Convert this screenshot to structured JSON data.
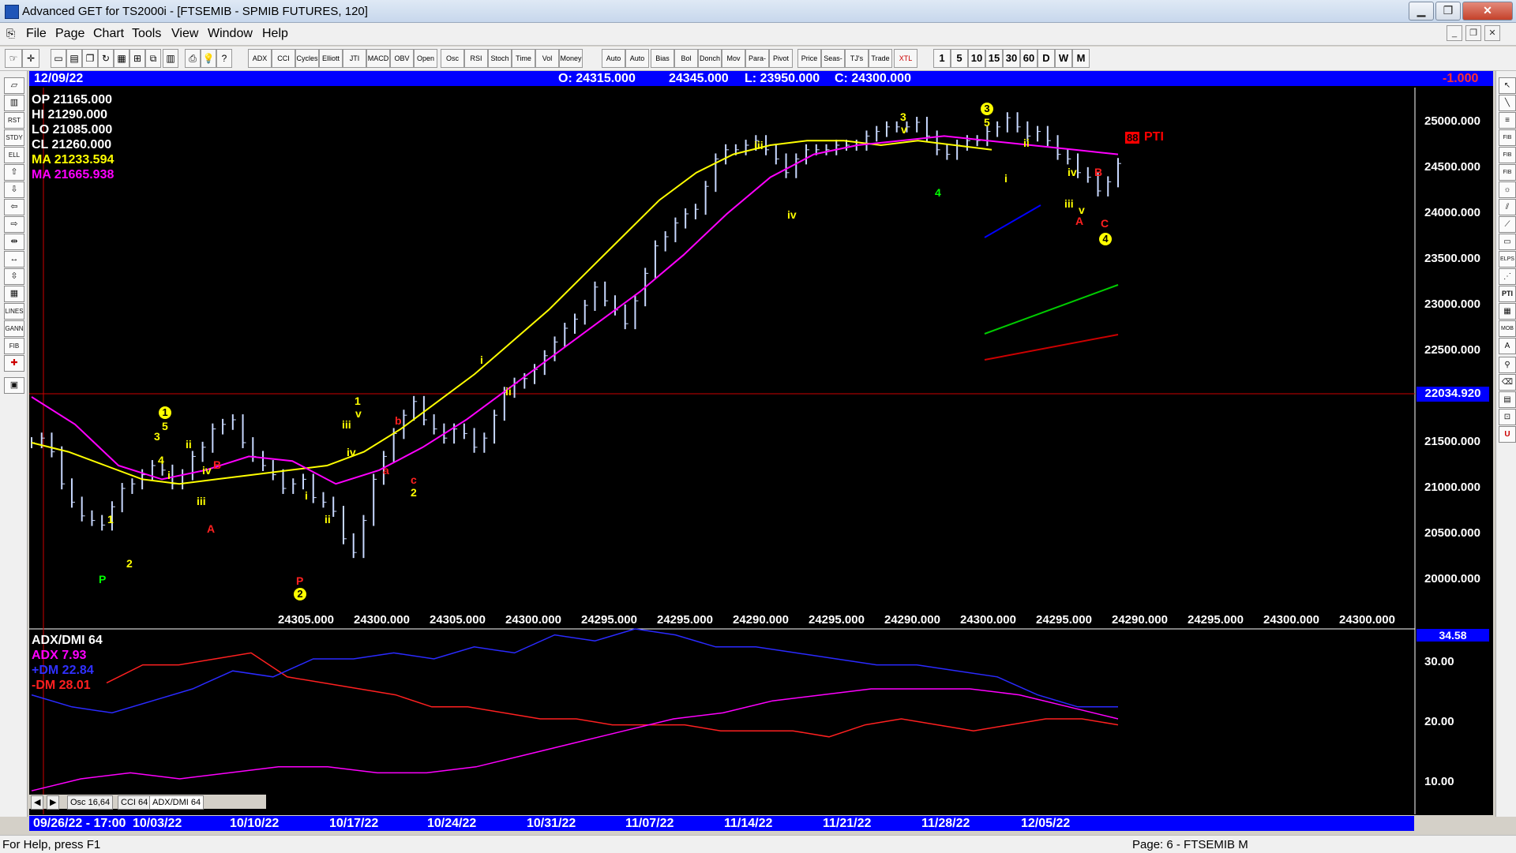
{
  "window": {
    "title": "Advanced GET for TS2000i - [FTSEMIB - SPMIB FUTURES, 120]",
    "min_label": "▁",
    "restore_label": "❐",
    "close_label": "✕"
  },
  "menu": {
    "items": [
      "File",
      "Page",
      "Chart",
      "Tools",
      "View",
      "Window",
      "Help"
    ]
  },
  "toolbar": {
    "indicators": [
      "ADX DMI",
      "CCI",
      "Cycles",
      "Elliott Trig",
      "JTI",
      "MACD",
      "OBV",
      "Open Int",
      "Osc",
      "RSI",
      "Stoch",
      "Time Clust",
      "Vol",
      "Money Flow",
      "Auto Gann",
      "Auto Trend",
      "Bias",
      "Bol Band",
      "Donch",
      "Mov Ave",
      "Para- bolic",
      "Pivot",
      "Price Clust",
      "Seas- onals",
      "TJ's Web",
      "Trade Profile",
      "XTL"
    ],
    "intervals": [
      "1",
      "5",
      "10",
      "15",
      "30",
      "60",
      "D",
      "W",
      "M"
    ]
  },
  "header": {
    "date": "12/09/22",
    "open": "O: 24315.000",
    "high": "24345.000",
    "low": "L:  23950.000",
    "close": "C:  24300.000",
    "change": "-1.000"
  },
  "ohlc_panel": {
    "op": "OP  21165.000",
    "hi": "HI   21290.000",
    "lo": "LO  21085.000",
    "cl": "CL   21260.000",
    "ma1": "MA  21233.594",
    "ma2": "MA  21665.938"
  },
  "price_axis": [
    "25000.000",
    "24500.000",
    "24000.000",
    "23500.000",
    "23000.000",
    "22500.000",
    "22000.000",
    "21500.000",
    "21000.000",
    "20500.000",
    "20000.000"
  ],
  "cursor_price": "22034.920",
  "pti": {
    "value": "88",
    "label": "PTI"
  },
  "bottom_values": [
    "24305.000",
    "24300.000",
    "24305.000",
    "24300.000",
    "24295.000",
    "24295.000",
    "24290.000",
    "24295.000",
    "24290.000",
    "24300.000",
    "24295.000",
    "24290.000",
    "24295.000",
    "24300.000",
    "24300.000"
  ],
  "adx": {
    "title": "ADX/DMI 64",
    "adx": "ADX 7.93",
    "pdm": "+DM 22.84",
    "mdm": "-DM  28.01",
    "current": "34.58",
    "axis": [
      "30.00",
      "20.00",
      "10.00"
    ]
  },
  "tabs": [
    "Osc 16,64",
    "CCI 64",
    "ADX/DMI 64"
  ],
  "dates": [
    "09/26/22 - 17:00",
    "10/03/22",
    "10/10/22",
    "10/17/22",
    "10/24/22",
    "10/31/22",
    "11/07/22",
    "11/14/22",
    "11/21/22",
    "11/28/22",
    "12/05/22"
  ],
  "status": {
    "help": "For Help, press F1",
    "page": "Page: 6 - FTSEMIB M"
  },
  "chart_data": {
    "type": "line",
    "price_ylim": [
      19700,
      25300
    ],
    "series": [
      {
        "values": [
          21250,
          21300,
          21150,
          20800,
          20600,
          20450,
          20400,
          20350,
          20550,
          20750,
          20800,
          20900,
          21000,
          20950,
          20800,
          20900,
          21100,
          21200,
          21400,
          21450,
          21500,
          21250,
          21100,
          21000,
          20900,
          20750,
          20800,
          20850,
          20650,
          20600,
          20500,
          20200,
          20050,
          20400,
          20850,
          21100,
          21350,
          21550,
          21700,
          21500,
          21400,
          21300,
          21400,
          21350,
          21200,
          21300,
          21550,
          21800,
          21900,
          21950,
          22050,
          22200,
          22350,
          22500,
          22600,
          22750,
          22950,
          22800,
          22700,
          22550,
          22800,
          23100,
          23400,
          23500,
          23650,
          23750,
          23800,
          24050,
          24350,
          24450,
          24450,
          24500,
          24550,
          24450,
          24350,
          24200,
          24350,
          24450,
          24450,
          24450,
          24500,
          24500,
          24500,
          24600,
          24650,
          24700,
          24700,
          24700,
          24750,
          24600,
          24450,
          24400,
          24500,
          24550,
          24550,
          24650,
          24700,
          24800,
          24700,
          24600,
          24650,
          24550,
          24400,
          24350,
          24200,
          24150,
          24000,
          24100,
          24300
        ]
      },
      {
        "values": [
          21250,
          21150,
          21000,
          20850,
          20800,
          20850,
          20900,
          20950,
          21000,
          21150,
          21400,
          21700,
          22000,
          22350,
          22700,
          23100,
          23500,
          23900,
          24200,
          24400,
          24500,
          24550,
          24550,
          24500,
          24550,
          24500,
          24450
        ]
      },
      {
        "values": [
          21750,
          21450,
          21000,
          20850,
          20950,
          21100,
          21050,
          20800,
          20950,
          21200,
          21500,
          21850,
          22200,
          22550,
          22900,
          23300,
          23750,
          24150,
          24400,
          24500,
          24550,
          24600,
          24550,
          24500,
          24450,
          24400
        ]
      },
      {
        "values": [
          26,
          29,
          29,
          30,
          31,
          27,
          26,
          25,
          24,
          22,
          22,
          21,
          20,
          20,
          19,
          19,
          19,
          18,
          18,
          18,
          17,
          19,
          20,
          19,
          18,
          19,
          20,
          20,
          19
        ]
      },
      {
        "values": [
          24,
          22,
          21,
          23,
          25,
          28,
          27,
          30,
          30,
          31,
          30,
          32,
          31,
          34,
          33,
          35,
          34,
          32,
          32,
          31,
          30,
          29,
          29,
          28,
          27,
          24,
          22,
          22
        ]
      },
      {
        "values": [
          8,
          10,
          11,
          10,
          11,
          12,
          12,
          11,
          11,
          12,
          14,
          16,
          18,
          20,
          21,
          23,
          24,
          25,
          25,
          25,
          24,
          22,
          20
        ]
      }
    ]
  }
}
